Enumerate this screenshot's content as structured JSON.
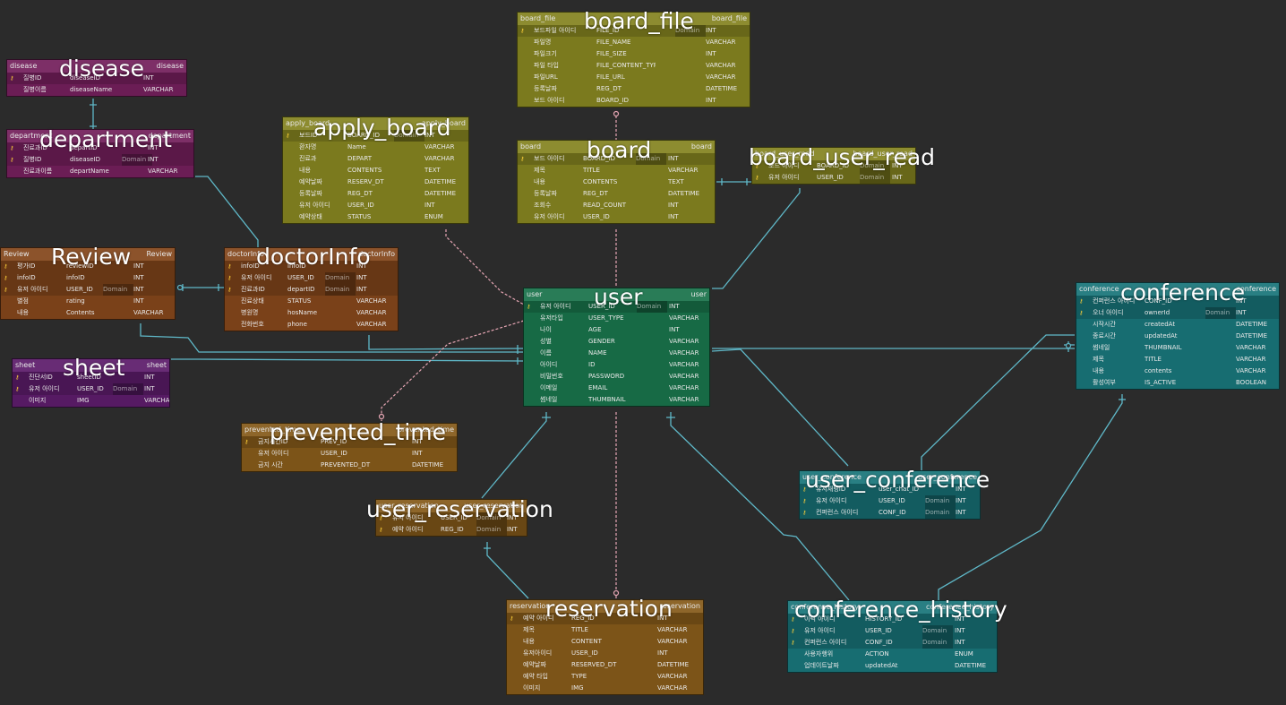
{
  "entities": {
    "disease": {
      "header_left": "disease",
      "header_right": "disease",
      "title": "disease",
      "color": "#6b1d55",
      "rows": [
        {
          "key": true,
          "name": "질병ID",
          "col": "diseaseID",
          "badge": "",
          "type": "INT"
        },
        {
          "key": false,
          "name": "질병이름",
          "col": "diseaseName",
          "badge": "",
          "type": "VARCHAR"
        }
      ]
    },
    "department": {
      "header_left": "department",
      "header_right": "department",
      "title": "department",
      "color": "#6b1d55",
      "rows": [
        {
          "key": true,
          "name": "진료과ID",
          "col": "departID",
          "badge": "",
          "type": "INT"
        },
        {
          "key": true,
          "name": "질병ID",
          "col": "diseaseID",
          "badge": "Domain",
          "type": "INT"
        },
        {
          "key": false,
          "name": "진료과이름",
          "col": "departName",
          "badge": "",
          "type": "VARCHAR"
        }
      ]
    },
    "apply_board": {
      "header_left": "apply_board",
      "header_right": "apply_board",
      "title": "apply_board",
      "color": "#7b7a1e",
      "rows": [
        {
          "key": true,
          "name": "보드ID",
          "col": "BOARD_ID",
          "badge": "Domain",
          "type": "INT"
        },
        {
          "key": false,
          "name": "환자명",
          "col": "Name",
          "badge": "",
          "type": "VARCHAR"
        },
        {
          "key": false,
          "name": "진료과",
          "col": "DEPART",
          "badge": "",
          "type": "VARCHAR"
        },
        {
          "key": false,
          "name": "내용",
          "col": "CONTENTS",
          "badge": "",
          "type": "TEXT"
        },
        {
          "key": false,
          "name": "예약날짜",
          "col": "RESERV_DT",
          "badge": "",
          "type": "DATETIME"
        },
        {
          "key": false,
          "name": "등록날짜",
          "col": "REG_DT",
          "badge": "",
          "type": "DATETIME"
        },
        {
          "key": false,
          "name": "유저 아이디",
          "col": "USER_ID",
          "badge": "",
          "type": "INT"
        },
        {
          "key": false,
          "name": "예약상태",
          "col": "STATUS",
          "badge": "",
          "type": "ENUM"
        }
      ]
    },
    "board_file": {
      "header_left": "board_file",
      "header_right": "board_file",
      "title": "board_file",
      "color": "#7b7a1e",
      "rows": [
        {
          "key": true,
          "name": "보드파일 아이디",
          "col": "FILE_ID",
          "badge": "Domain",
          "type": "INT"
        },
        {
          "key": false,
          "name": "파일명",
          "col": "FILE_NAME",
          "badge": "",
          "type": "VARCHAR"
        },
        {
          "key": false,
          "name": "파일크기",
          "col": "FILE_SIZE",
          "badge": "",
          "type": "INT"
        },
        {
          "key": false,
          "name": "파일 타입",
          "col": "FILE_CONTENT_TYPE",
          "badge": "",
          "type": "VARCHAR"
        },
        {
          "key": false,
          "name": "파일URL",
          "col": "FILE_URL",
          "badge": "",
          "type": "VARCHAR"
        },
        {
          "key": false,
          "name": "등록날짜",
          "col": "REG_DT",
          "badge": "",
          "type": "DATETIME"
        },
        {
          "key": false,
          "name": "보드 아이디",
          "col": "BOARD_ID",
          "badge": "",
          "type": "INT"
        }
      ]
    },
    "board": {
      "header_left": "board",
      "header_right": "board",
      "title": "board",
      "color": "#7b7a1e",
      "rows": [
        {
          "key": true,
          "name": "보드 아이디",
          "col": "BOARD_ID",
          "badge": "Domain",
          "type": "INT"
        },
        {
          "key": false,
          "name": "제목",
          "col": "TITLE",
          "badge": "",
          "type": "VARCHAR"
        },
        {
          "key": false,
          "name": "내용",
          "col": "CONTENTS",
          "badge": "",
          "type": "TEXT"
        },
        {
          "key": false,
          "name": "등록날짜",
          "col": "REG_DT",
          "badge": "",
          "type": "DATETIME"
        },
        {
          "key": false,
          "name": "조회수",
          "col": "READ_COUNT",
          "badge": "",
          "type": "INT"
        },
        {
          "key": false,
          "name": "유저 아이디",
          "col": "USER_ID",
          "badge": "",
          "type": "INT"
        }
      ]
    },
    "board_user_read": {
      "header_left": "board_user_read",
      "header_right": "board_user_read",
      "title": "board_user_read",
      "color": "#7b7a1e",
      "rows": [
        {
          "key": true,
          "name": "보드 아이디",
          "col": "BOARD_ID",
          "badge": "Domain",
          "type": "INT"
        },
        {
          "key": true,
          "name": "유저 아이디",
          "col": "USER_ID",
          "badge": "Domain",
          "type": "INT"
        }
      ]
    },
    "Review": {
      "header_left": "Review",
      "header_right": "Review",
      "title": "Review",
      "color": "#7a4119",
      "rows": [
        {
          "key": true,
          "name": "평가ID",
          "col": "reviewID",
          "badge": "",
          "type": "INT"
        },
        {
          "key": true,
          "name": "infoID",
          "col": "infoID",
          "badge": "",
          "type": "INT"
        },
        {
          "key": true,
          "name": "유저 아이디",
          "col": "USER_ID",
          "badge": "Domain",
          "type": "INT"
        },
        {
          "key": false,
          "name": "별점",
          "col": "rating",
          "badge": "",
          "type": "INT"
        },
        {
          "key": false,
          "name": "내용",
          "col": "Contents",
          "badge": "",
          "type": "VARCHAR"
        }
      ]
    },
    "doctorInfo": {
      "header_left": "doctorInfo",
      "header_right": "doctorInfo",
      "title": "doctorInfo",
      "color": "#7a4119",
      "rows": [
        {
          "key": true,
          "name": "infoID",
          "col": "infoID",
          "badge": "",
          "type": "INT"
        },
        {
          "key": true,
          "name": "유저 아이디",
          "col": "USER_ID",
          "badge": "Domain",
          "type": "INT"
        },
        {
          "key": true,
          "name": "진료과ID",
          "col": "departID",
          "badge": "Domain",
          "type": "INT"
        },
        {
          "key": false,
          "name": "진료상태",
          "col": "STATUS",
          "badge": "",
          "type": "VARCHAR"
        },
        {
          "key": false,
          "name": "병원명",
          "col": "hosName",
          "badge": "",
          "type": "VARCHAR"
        },
        {
          "key": false,
          "name": "전화번호",
          "col": "phone",
          "badge": "",
          "type": "VARCHAR"
        }
      ]
    },
    "sheet": {
      "header_left": "sheet",
      "header_right": "sheet",
      "title": "sheet",
      "color": "#561a63",
      "rows": [
        {
          "key": true,
          "name": "진단서ID",
          "col": "sheetID",
          "badge": "",
          "type": "INT"
        },
        {
          "key": true,
          "name": "유저 아이디",
          "col": "USER_ID",
          "badge": "Domain",
          "type": "INT"
        },
        {
          "key": false,
          "name": "이미지",
          "col": "IMG",
          "badge": "",
          "type": "VARCHAR"
        }
      ]
    },
    "user": {
      "header_left": "user",
      "header_right": "user",
      "title": "user",
      "color": "#176a45",
      "rows": [
        {
          "key": true,
          "name": "유저 아이디",
          "col": "USER_ID",
          "badge": "Domain",
          "type": "INT"
        },
        {
          "key": false,
          "name": "유저타입",
          "col": "USER_TYPE",
          "badge": "",
          "type": "VARCHAR"
        },
        {
          "key": false,
          "name": "나이",
          "col": "AGE",
          "badge": "",
          "type": "INT"
        },
        {
          "key": false,
          "name": "성별",
          "col": "GENDER",
          "badge": "",
          "type": "VARCHAR"
        },
        {
          "key": false,
          "name": "이름",
          "col": "NAME",
          "badge": "",
          "type": "VARCHAR"
        },
        {
          "key": false,
          "name": "아이디",
          "col": "ID",
          "badge": "",
          "type": "VARCHAR"
        },
        {
          "key": false,
          "name": "비밀번호",
          "col": "PASSWORD",
          "badge": "",
          "type": "VARCHAR"
        },
        {
          "key": false,
          "name": "이메일",
          "col": "EMAIL",
          "badge": "",
          "type": "VARCHAR"
        },
        {
          "key": false,
          "name": "썸네일",
          "col": "THUMBNAIL",
          "badge": "",
          "type": "VARCHAR"
        }
      ]
    },
    "conference": {
      "header_left": "conference",
      "header_right": "conference",
      "title": "conference",
      "color": "#176d71",
      "rows": [
        {
          "key": true,
          "name": "컨퍼런스 아이디",
          "col": "CONF_ID",
          "badge": "",
          "type": "INT"
        },
        {
          "key": true,
          "name": "오너 아이디",
          "col": "ownerId",
          "badge": "Domain",
          "type": "INT"
        },
        {
          "key": false,
          "name": "시작시간",
          "col": "createdAt",
          "badge": "",
          "type": "DATETIME"
        },
        {
          "key": false,
          "name": "종료시간",
          "col": "updatedAt",
          "badge": "",
          "type": "DATETIME"
        },
        {
          "key": false,
          "name": "썸네일",
          "col": "THUMBNAIL",
          "badge": "",
          "type": "VARCHAR"
        },
        {
          "key": false,
          "name": "제목",
          "col": "TITLE",
          "badge": "",
          "type": "VARCHAR"
        },
        {
          "key": false,
          "name": "내용",
          "col": "contents",
          "badge": "",
          "type": "VARCHAR"
        },
        {
          "key": false,
          "name": "활성여부",
          "col": "IS_ACTIVE",
          "badge": "",
          "type": "BOOLEAN"
        }
      ]
    },
    "prevented_time": {
      "header_left": "prevented_time",
      "header_right": "prevented_time",
      "title": "prevented_time",
      "color": "#7c5418",
      "rows": [
        {
          "key": true,
          "name": "금지시간ID",
          "col": "PREV_ID",
          "badge": "",
          "type": "INT"
        },
        {
          "key": false,
          "name": "유저 아이디",
          "col": "USER_ID",
          "badge": "",
          "type": "INT"
        },
        {
          "key": false,
          "name": "금지 시간",
          "col": "PREVENTED_DT",
          "badge": "",
          "type": "DATETIME"
        }
      ]
    },
    "user_reservation": {
      "header_left": "user_reservation",
      "header_right": "user_reservation",
      "title": "user_reservation",
      "color": "#7c5418",
      "rows": [
        {
          "key": true,
          "name": "유저 아이디",
          "col": "USER_ID",
          "badge": "Domain",
          "type": "INT"
        },
        {
          "key": true,
          "name": "예약 아이디",
          "col": "REG_ID",
          "badge": "Domain",
          "type": "INT"
        }
      ]
    },
    "user_conference": {
      "header_left": "user_conference",
      "header_right": "user_conference",
      "title": "user_conference",
      "color": "#176d71",
      "rows": [
        {
          "key": true,
          "name": "유저채팅ID",
          "col": "user_chat_ID",
          "badge": "",
          "type": "INT"
        },
        {
          "key": true,
          "name": "유저 아이디",
          "col": "USER_ID",
          "badge": "Domain",
          "type": "INT"
        },
        {
          "key": true,
          "name": "컨퍼런스 아이디",
          "col": "CONF_ID",
          "badge": "Domain",
          "type": "INT"
        }
      ]
    },
    "reservation": {
      "header_left": "reservation",
      "header_right": "reservation",
      "title": "reservation",
      "color": "#7c5418",
      "rows": [
        {
          "key": true,
          "name": "예약 아이디",
          "col": "REG_ID",
          "badge": "",
          "type": "INT"
        },
        {
          "key": false,
          "name": "제목",
          "col": "TITLE",
          "badge": "",
          "type": "VARCHAR"
        },
        {
          "key": false,
          "name": "내용",
          "col": "CONTENT",
          "badge": "",
          "type": "VARCHAR"
        },
        {
          "key": false,
          "name": "유저아이디",
          "col": "USER_ID",
          "badge": "",
          "type": "INT"
        },
        {
          "key": false,
          "name": "예약날짜",
          "col": "RESERVED_DT",
          "badge": "",
          "type": "DATETIME"
        },
        {
          "key": false,
          "name": "예약 타입",
          "col": "TYPE",
          "badge": "",
          "type": "VARCHAR"
        },
        {
          "key": false,
          "name": "이미지",
          "col": "IMG",
          "badge": "",
          "type": "VARCHAR"
        }
      ]
    },
    "conference_history": {
      "header_left": "conference_history",
      "header_right": "conference_history",
      "title": "conference_history",
      "color": "#176d71",
      "rows": [
        {
          "key": true,
          "name": "이력 아이디",
          "col": "HISTORY_ID",
          "badge": "",
          "type": "INT"
        },
        {
          "key": true,
          "name": "유저 아이디",
          "col": "USER_ID",
          "badge": "Domain",
          "type": "INT"
        },
        {
          "key": true,
          "name": "컨퍼런스 아이디",
          "col": "CONF_ID",
          "badge": "Domain",
          "type": "INT"
        },
        {
          "key": false,
          "name": "사용자행위",
          "col": "ACTION",
          "badge": "",
          "type": "ENUM"
        },
        {
          "key": false,
          "name": "업데이트날짜",
          "col": "updatedAt",
          "badge": "",
          "type": "DATETIME"
        }
      ]
    }
  },
  "colors": {
    "background": "#2b2b2b",
    "relationship_line": "#5fb8c8",
    "dashed_relationship_line": "#e6a6b4",
    "key_icon": "#ffd23a"
  }
}
